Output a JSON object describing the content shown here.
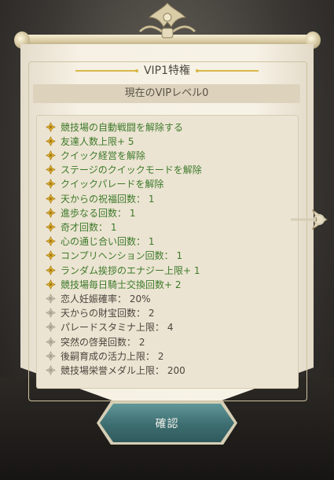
{
  "dialog": {
    "title": "VIP1特権",
    "current_level": "現在のVIPレベル0"
  },
  "benefits": [
    {
      "text": "競技場の自動戦闘を解除する",
      "active": true
    },
    {
      "text": "友達人数上限+ 5",
      "active": true
    },
    {
      "text": "クイック経営を解除",
      "active": true
    },
    {
      "text": "ステージのクイックモードを解除",
      "active": true
    },
    {
      "text": "クイックパレードを解除",
      "active": true
    },
    {
      "text": "天からの祝福回数： 1",
      "active": true
    },
    {
      "text": "進歩なる回数： 1",
      "active": true
    },
    {
      "text": "奇才回数： 1",
      "active": true
    },
    {
      "text": "心の通じ合い回数： 1",
      "active": true
    },
    {
      "text": "コンプリヘンション回数： 1",
      "active": true
    },
    {
      "text": "ランダム挨拶のエナジー上限+ 1",
      "active": true
    },
    {
      "text": "競技場毎日騎士交換回数+ 2",
      "active": true
    },
    {
      "text": "恋人妊娠確率： 20%",
      "active": false
    },
    {
      "text": "天からの財宝回数： 2",
      "active": false
    },
    {
      "text": "パレードスタミナ上限： 4",
      "active": false
    },
    {
      "text": "突然の啓発回数： 2",
      "active": false
    },
    {
      "text": "後嗣育成の活力上限： 2",
      "active": false
    },
    {
      "text": "競技場栄誉メダル上限： 200",
      "active": false
    }
  ],
  "confirm_button": {
    "label": "確認"
  },
  "icons": {
    "active_item": "gold-flower-icon",
    "inactive_item": "grey-flower-icon",
    "side_arrow": "arrow-right-icon",
    "crest": "crown-crest-icon"
  },
  "colors": {
    "active_text": "#3d7a2b",
    "inactive_text": "#4a463f",
    "button": "#3d6d70",
    "parchment": "#f6f1e4"
  }
}
